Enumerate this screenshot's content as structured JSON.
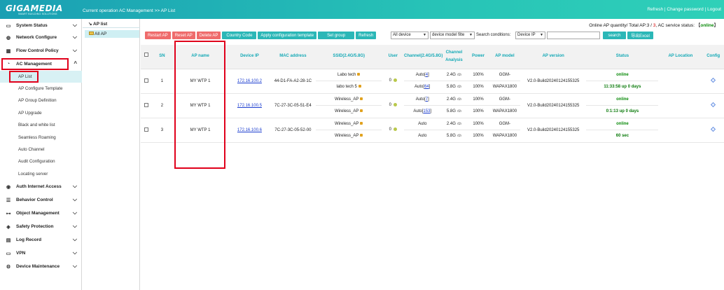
{
  "header": {
    "logo": "GIGAMEDIA",
    "logo_tagline": "SMART BUILDING SOLUTIONS",
    "breadcrumb": "Current operation  AC Management >> AP List",
    "links": [
      "Refresh",
      "Change password",
      "Logout"
    ],
    "bg_color": "#1fb5b8"
  },
  "sidebar": {
    "items": [
      {
        "label": "System Status",
        "icon": "monitor-icon"
      },
      {
        "label": "Network Configure",
        "icon": "globe-icon"
      },
      {
        "label": "Flow Control Policy",
        "icon": "chart-icon"
      },
      {
        "label": "AC Management",
        "icon": "wifi-icon"
      },
      {
        "label": "Auth Internet Access",
        "icon": "globe-lock-icon"
      },
      {
        "label": "Behavior Control",
        "icon": "list-icon"
      },
      {
        "label": "Object Management",
        "icon": "node-icon"
      },
      {
        "label": "Safety Protection",
        "icon": "shield-icon"
      },
      {
        "label": "Log Record",
        "icon": "log-icon"
      },
      {
        "label": "VPN",
        "icon": "vpn-icon"
      },
      {
        "label": "Device Maintenance",
        "icon": "gear-icon"
      }
    ],
    "subitems": [
      "AP List",
      "AP Configure Template",
      "AP Group Definition",
      "AP Upgrade",
      "Black and white list",
      "Seamless Roaming",
      "Auto Channel",
      "Audit Configuration",
      "Locating server"
    ]
  },
  "tree": {
    "title": "AP list",
    "node": "All AP"
  },
  "status": {
    "prefix": "Online AP quantity/ Total AP:",
    "online": "3",
    "total": "3",
    "service_prefix": ", AC service status: ",
    "service": "online"
  },
  "toolbar": {
    "restart": "Restart AP",
    "reset": "Reset AP",
    "delete": "Delete AP",
    "country": "Country Code",
    "apply_template": "Apply configuration template",
    "set_group": "Set group",
    "refresh": "Refresh",
    "all_device": "All device",
    "model_filter": "device model filte",
    "search_conditions": "Search conditions:",
    "device_ip": "Device IP",
    "search": "search",
    "export": "导出Excel"
  },
  "table": {
    "headers": [
      "SN",
      "AP name",
      "Device IP",
      "MAC address",
      "SSID(2.4G/5.8G)",
      "User",
      "Channel(2.4G/5.8G)",
      "Channel Analysis",
      "Power",
      "AP model",
      "AP version",
      "Status",
      "AP Location",
      "Config"
    ],
    "rows": [
      {
        "sn": "1",
        "name": "MY WTP 1",
        "ip": "172.16.100.2",
        "mac": "44-D1-FA-A2-28-1C",
        "ssid": [
          "Labo tech",
          "labo tech 5"
        ],
        "user": "0",
        "channel": [
          {
            "mode": "Auto",
            "num": "4"
          },
          {
            "mode": "Auto",
            "num": "64"
          }
        ],
        "band": [
          "2.4G",
          "5.8G"
        ],
        "power": [
          "100%",
          "100%"
        ],
        "model": [
          "GGM-",
          "WAPAX1800"
        ],
        "version": "V2.0-Build20240124155325",
        "status": "online",
        "uptime": "11:33:58 up 0 days"
      },
      {
        "sn": "2",
        "name": "MY WTP 1",
        "ip": "172.16.100.5",
        "mac": "7C-27-3C-05-51-E4",
        "ssid": [
          "Wireless_AP",
          "Wireless_AP"
        ],
        "user": "0",
        "channel": [
          {
            "mode": "Auto",
            "num": "7"
          },
          {
            "mode": "Auto",
            "num": "153"
          }
        ],
        "band": [
          "2.4G",
          "5.8G"
        ],
        "power": [
          "100%",
          "100%"
        ],
        "model": [
          "GGM-",
          "WAPAX1800"
        ],
        "version": "V2.0-Build20240124155325",
        "status": "online",
        "uptime": "0:1:13 up 0 days"
      },
      {
        "sn": "3",
        "name": "MY WTP 1",
        "ip": "172.16.100.6",
        "mac": "7C-27-3C-05-52-00",
        "ssid": [
          "Wireless_AP",
          "Wireless_AP"
        ],
        "user": "0",
        "channel": [
          {
            "mode": "Auto",
            "num": ""
          },
          {
            "mode": "Auto",
            "num": ""
          }
        ],
        "band": [
          "2.4G",
          "5.8G"
        ],
        "power": [
          "100%",
          "100%"
        ],
        "model": [
          "GGM-",
          "WAPAX1800"
        ],
        "version": "V2.0-Build20240124155325",
        "status": "online",
        "uptime": "60 sec"
      }
    ]
  }
}
